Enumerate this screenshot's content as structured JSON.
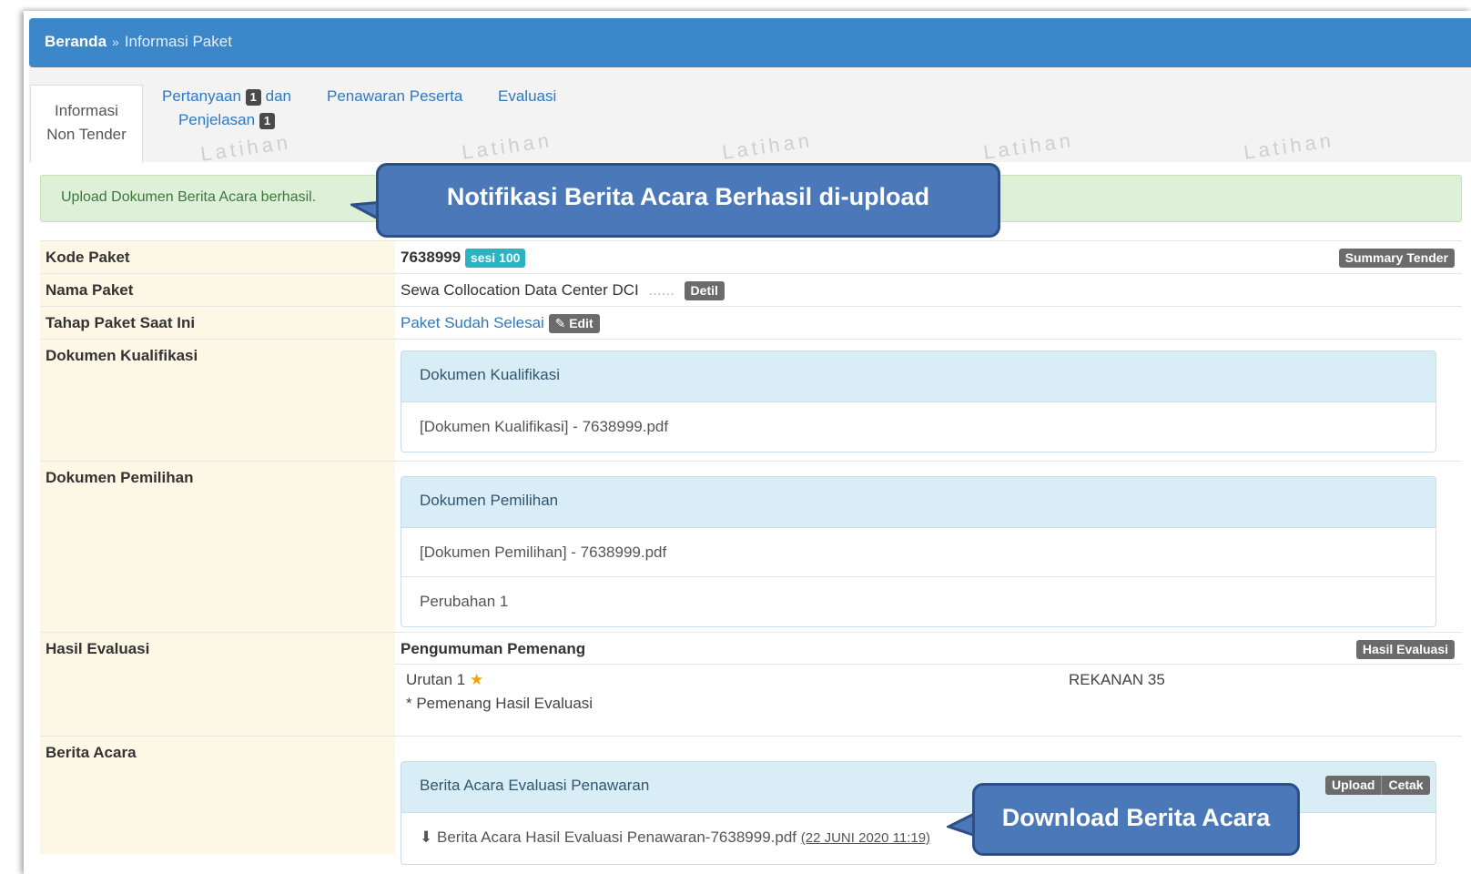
{
  "breadcrumb": {
    "home": "Beranda",
    "separator": "»",
    "current": "Informasi Paket"
  },
  "tabs": [
    {
      "line1": "Informasi",
      "line2": "Non Tender"
    },
    {
      "line1": "Pertanyaan",
      "badge1": "1",
      "line1b": "dan",
      "line2": "Penjelasan",
      "badge2": "1"
    },
    {
      "line1": "Penawaran Peserta"
    },
    {
      "line1": "Evaluasi"
    }
  ],
  "watermark": "Latihan",
  "alert": "Upload Dokumen Berita Acara berhasil.",
  "callouts": {
    "top": "Notifikasi Berita Acara Berhasil di-upload",
    "bottom": "Download Berita Acara"
  },
  "rows": {
    "kode": {
      "label": "Kode Paket",
      "value": "7638999",
      "badge": "sesi 100",
      "button": "Summary Tender"
    },
    "nama": {
      "label": "Nama Paket",
      "value": "Sewa Collocation Data Center DCI",
      "button": "Detil"
    },
    "tahap": {
      "label": "Tahap Paket Saat Ini",
      "value": "Paket Sudah Selesai",
      "button": "Edit"
    },
    "kualifikasi": {
      "label": "Dokumen Kualifikasi",
      "panel_title": "Dokumen Kualifikasi",
      "items": [
        "[Dokumen Kualifikasi] - 7638999.pdf"
      ]
    },
    "pemilihan": {
      "label": "Dokumen Pemilihan",
      "panel_title": "Dokumen Pemilihan",
      "items": [
        "[Dokumen Pemilihan] - 7638999.pdf",
        "Perubahan 1"
      ]
    },
    "hasil": {
      "label": "Hasil Evaluasi",
      "title": "Pengumuman Pemenang",
      "button": "Hasil Evaluasi",
      "urutan": "Urutan 1",
      "rekanan": "REKANAN 35",
      "note": "* Pemenang Hasil Evaluasi"
    },
    "berita": {
      "label": "Berita Acara",
      "panel_title": "Berita Acara Evaluasi Penawaran",
      "upload": "Upload",
      "cetak": "Cetak",
      "file": "Berita Acara Hasil Evaluasi Penawaran-7638999.pdf",
      "date": "(22 JUNI 2020 11:19)"
    }
  }
}
